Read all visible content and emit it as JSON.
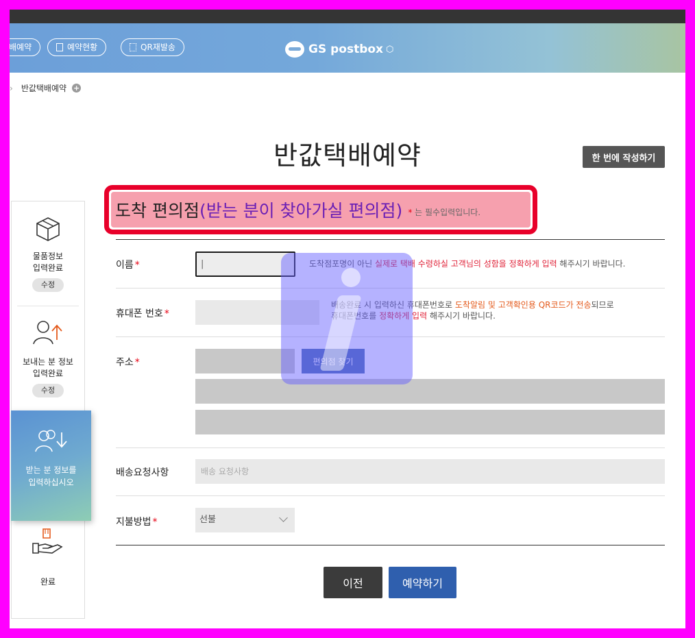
{
  "header": {
    "nav": [
      "배예약",
      "예약현황",
      "QR재발송"
    ],
    "logo": "GS postbox"
  },
  "breadcrumb": {
    "current": "반값택배예약",
    "plus": "+"
  },
  "page": {
    "title": "반값택배예약",
    "oneclick_label": "한 번에 작성하기"
  },
  "section": {
    "title": "도착 편의점",
    "subtitle": "(받는 분이 찾아가실 편의점)",
    "req_star": "*",
    "req_note": "는 필수입력입니다."
  },
  "steps": [
    {
      "label1": "물품정보",
      "label2": "입력완료",
      "edit": "수정"
    },
    {
      "label1": "보내는 분 정보",
      "label2": "입력완료",
      "edit": "수정"
    },
    {
      "label1": "받는 분 정보를",
      "label2": "입력하십시오"
    },
    {
      "label1": "완료"
    }
  ],
  "form": {
    "name": {
      "label": "이름",
      "star": "*",
      "value": "|",
      "hint_a": "도착점포명이 아닌 ",
      "hint_b": "실제로 택배 수령하실 고객님의 성함을 정확하게 입력",
      "hint_c": " 해주시기 바랍니다."
    },
    "phone": {
      "label": "휴대폰 번호",
      "star": "*",
      "hint1_a": "배송완료 시 입력하신 휴대폰번호로 ",
      "hint1_b": "도착알림 및 고객확인용 QR코드가 전송",
      "hint1_c": "되므로",
      "hint2_a": "휴대폰번호를 ",
      "hint2_b": "정확하게 입력",
      "hint2_c": " 해주시기 바랍니다."
    },
    "address": {
      "label": "주소",
      "star": "*",
      "find_label": "편의점 찾기"
    },
    "request": {
      "label": "배송요청사항",
      "placeholder": "배송 요청사항"
    },
    "payment": {
      "label": "지불방법",
      "star": "*",
      "value": "선불"
    }
  },
  "buttons": {
    "prev": "이전",
    "reserve": "예약하기"
  },
  "colors": {
    "accent_red": "#e8002a",
    "primary_blue": "#2f5fae",
    "highlight_pink": "#f6a0ae"
  }
}
